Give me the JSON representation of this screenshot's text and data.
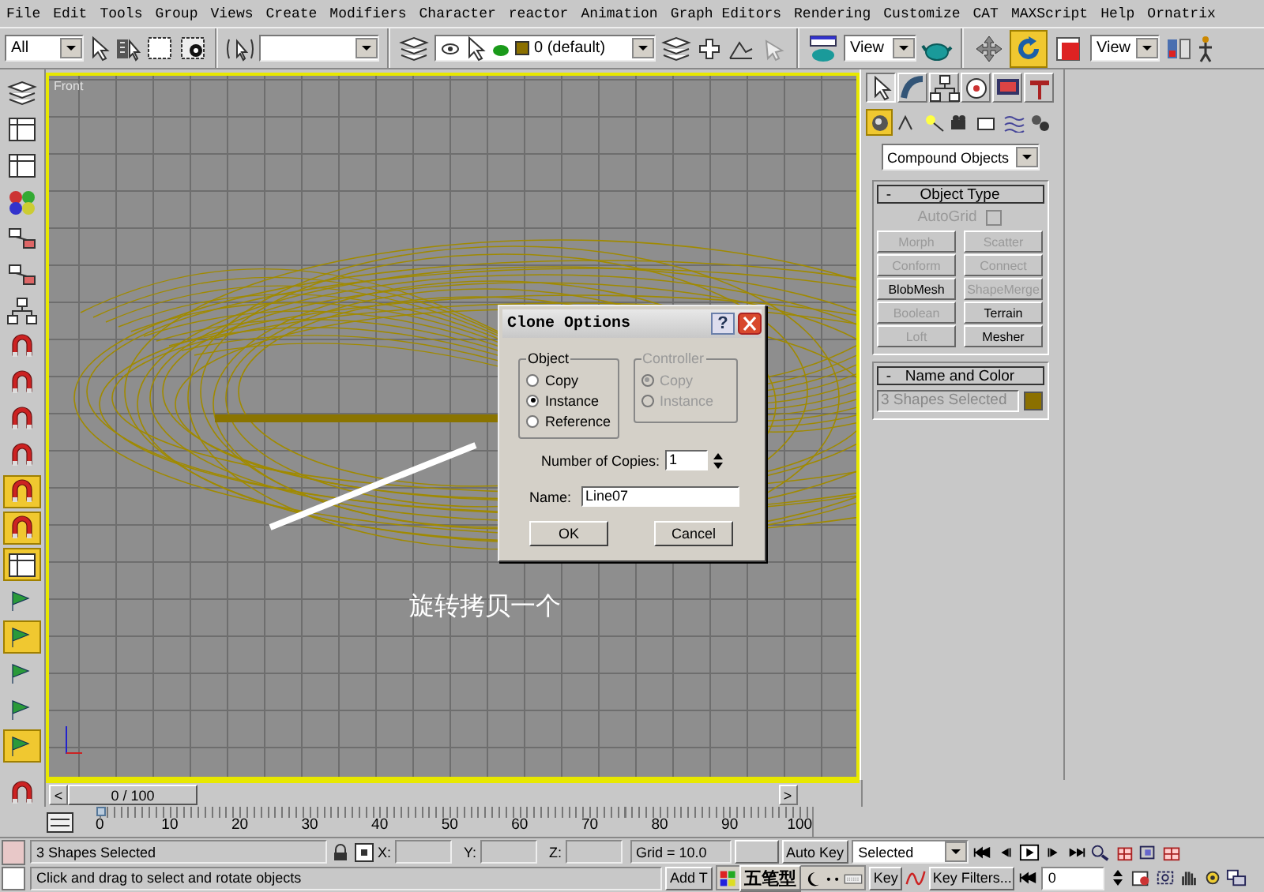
{
  "menu": [
    "File",
    "Edit",
    "Tools",
    "Group",
    "Views",
    "Create",
    "Modifiers",
    "Character",
    "reactor",
    "Animation",
    "Graph Editors",
    "Rendering",
    "Customize",
    "CAT",
    "MAXScript",
    "Help",
    "Ornatrix"
  ],
  "toolbar": {
    "selection_filter": "All",
    "layer": "0 (default)",
    "reference_coordinate": "View",
    "render_type": "View",
    "transform_tools": [
      {
        "selected": false
      },
      {
        "selected": true
      },
      {
        "selected": false
      }
    ]
  },
  "left_toolbar": [
    {
      "selected": false
    },
    {
      "selected": false
    },
    {
      "selected": false
    },
    {
      "selected": false
    },
    {
      "selected": false
    },
    {
      "selected": false
    },
    {
      "selected": false
    },
    {
      "selected": false
    },
    {
      "selected": false
    },
    {
      "selected": false
    },
    {
      "selected": false
    },
    {
      "selected": true
    },
    {
      "selected": true
    },
    {
      "selected": true
    },
    {
      "selected": false
    },
    {
      "selected": true
    },
    {
      "selected": false
    },
    {
      "selected": false
    },
    {
      "selected": true
    }
  ],
  "viewport": {
    "label": "Front",
    "active": true,
    "caption": "旋转拷贝一个"
  },
  "command_panel": {
    "tabs": [
      {
        "selected": true
      },
      {
        "selected": false
      },
      {
        "selected": false
      },
      {
        "selected": false
      },
      {
        "selected": false
      },
      {
        "selected": false
      }
    ],
    "categories": [
      {
        "selected": true
      },
      {
        "selected": false
      },
      {
        "selected": false
      },
      {
        "selected": false
      },
      {
        "selected": false
      },
      {
        "selected": false
      },
      {
        "selected": false
      }
    ],
    "category_dropdown": "Compound Objects",
    "object_type": {
      "toggle": "-",
      "title": "Object Type",
      "autogrid": {
        "label": "AutoGrid",
        "checked": false,
        "disabled": true
      },
      "buttons": [
        {
          "label": "Morph",
          "disabled": true
        },
        {
          "label": "Scatter",
          "disabled": true
        },
        {
          "label": "Conform",
          "disabled": true
        },
        {
          "label": "Connect",
          "disabled": true
        },
        {
          "label": "BlobMesh",
          "disabled": false
        },
        {
          "label": "ShapeMerge",
          "disabled": true
        },
        {
          "label": "Boolean",
          "disabled": true
        },
        {
          "label": "Terrain",
          "disabled": false
        },
        {
          "label": "Loft",
          "disabled": true
        },
        {
          "label": "Mesher",
          "disabled": false
        }
      ]
    },
    "name_and_color": {
      "toggle": "-",
      "title": "Name and Color",
      "name": "3 Shapes Selected",
      "color": "#8b7000"
    }
  },
  "dialog": {
    "title": "Clone Options",
    "help_button": "?",
    "object": {
      "title": "Object",
      "disabled": false,
      "options": [
        {
          "label": "Copy",
          "selected": false
        },
        {
          "label": "Instance",
          "selected": true
        },
        {
          "label": "Reference",
          "selected": false
        }
      ]
    },
    "controller": {
      "title": "Controller",
      "disabled": true,
      "options": [
        {
          "label": "Copy",
          "selected": true
        },
        {
          "label": "Instance",
          "selected": false
        }
      ]
    },
    "copies_label": "Number of Copies:",
    "copies": "1",
    "name_label": "Name:",
    "name": "Line07",
    "buttons": [
      "OK",
      "Cancel"
    ]
  },
  "timeline": {
    "prev": "<",
    "position": "0 / 100",
    "level": 0,
    "next": ">",
    "ticks": [
      "0",
      "10",
      "20",
      "30",
      "40",
      "50",
      "60",
      "70",
      "80",
      "90",
      "100"
    ]
  },
  "status": {
    "selection": "3 Shapes Selected",
    "prompt": "Click and drag to select and rotate objects",
    "x_label": "X:",
    "y_label": "Y:",
    "z_label": "Z:",
    "grid": "Grid = 10.0",
    "auto_key": "Auto Key",
    "key_mode": "Selected",
    "add_time_tag": "Add T",
    "set_key": "Key",
    "key_filters": "Key Filters...",
    "frame": "0"
  },
  "ime_bar": {
    "mode": "五笔型"
  }
}
